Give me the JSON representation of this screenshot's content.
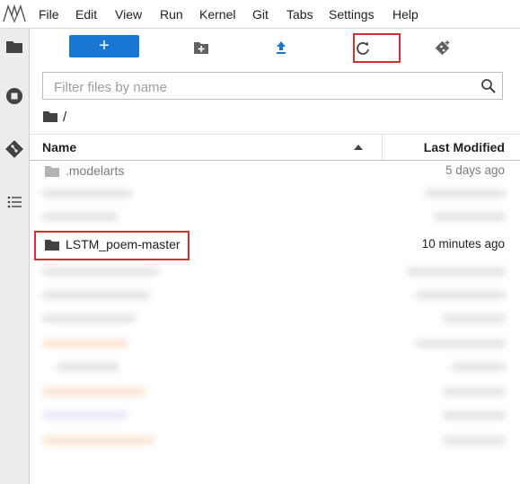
{
  "menu": {
    "items": [
      "File",
      "Edit",
      "View",
      "Run",
      "Kernel",
      "Git",
      "Tabs",
      "Settings",
      "Help"
    ]
  },
  "toolbar": {
    "new_label": "+"
  },
  "filter": {
    "placeholder": "Filter files by name",
    "value": ""
  },
  "breadcrumb": {
    "path": "/"
  },
  "listing": {
    "columns": {
      "name": "Name",
      "modified": "Last Modified"
    },
    "sort": "name-ascending",
    "rows": [
      {
        "name": ".modelarts",
        "modified": "5 days ago",
        "type": "folder"
      },
      {
        "name": "LSTM_poem-master",
        "modified": "10 minutes ago",
        "type": "folder"
      }
    ]
  },
  "colors": {
    "accent": "#1976d2",
    "highlight": "#d32f2f",
    "rail": "#ececec"
  },
  "icons": [
    "folder-icon",
    "stop-circle-icon",
    "git-icon",
    "list-icon",
    "new-folder-icon",
    "upload-icon",
    "refresh-icon",
    "git-clone-icon",
    "search-icon",
    "sort-up-icon"
  ]
}
